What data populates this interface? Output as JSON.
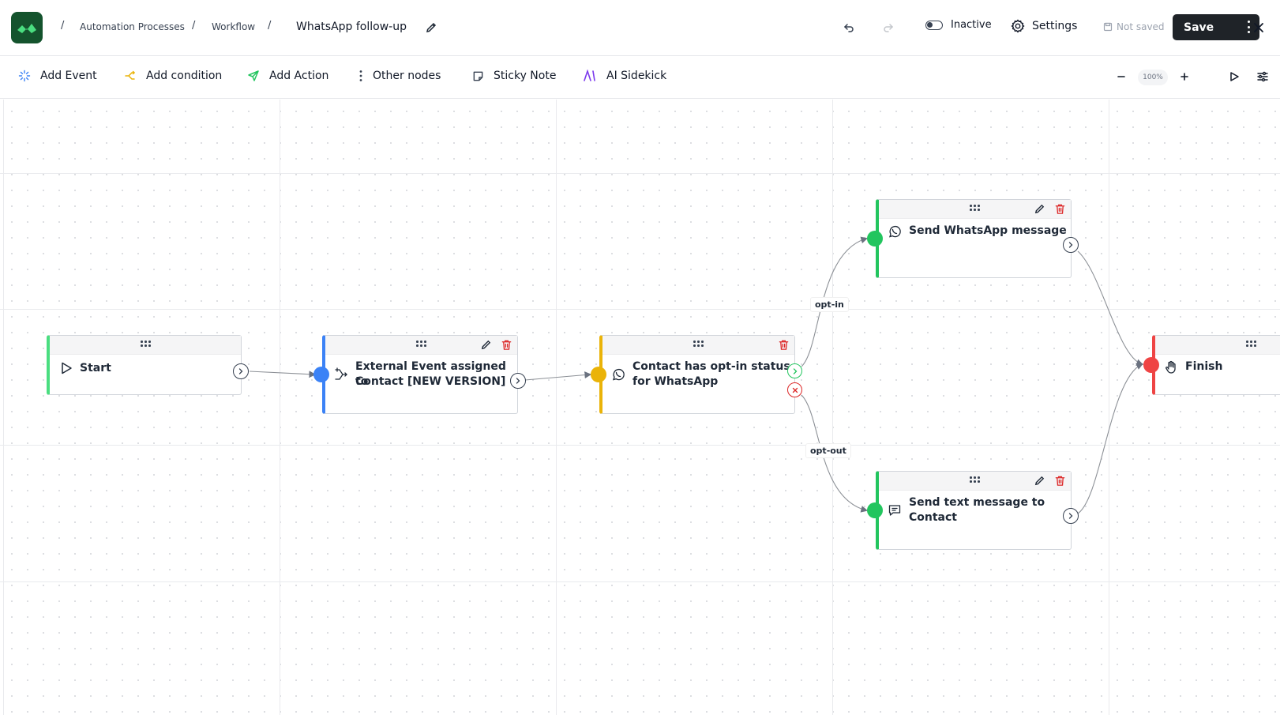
{
  "header": {
    "breadcrumbs": [
      "Automation Processes",
      "Workflow"
    ],
    "workflow_name": "WhatsApp follow-up",
    "status_label": "Inactive",
    "settings_label": "Settings",
    "save_state": "Not saved",
    "save_label": "Save"
  },
  "toolbar": {
    "add_event": "Add Event",
    "add_condition": "Add condition",
    "add_action": "Add Action",
    "other_nodes": "Other nodes",
    "sticky_note": "Sticky Note",
    "ai_sidekick": "AI Sidekick",
    "zoom": "100%"
  },
  "nodes": {
    "start": {
      "title": "Start",
      "color": "#4ade80"
    },
    "external_event": {
      "title_line1": "External Event assigned to",
      "title_line2": "Contact [NEW VERSION]",
      "color": "#3b82f6"
    },
    "condition": {
      "title_line1": "Contact has opt-in status",
      "title_line2": "for WhatsApp",
      "color": "#eab308"
    },
    "send_whatsapp": {
      "title": "Send WhatsApp message",
      "color": "#22c55e"
    },
    "send_text": {
      "title_line1": "Send text message to",
      "title_line2": "Contact",
      "color": "#22c55e"
    },
    "finish": {
      "title": "Finish",
      "color": "#ef4444"
    }
  },
  "edges": {
    "opt_in_label": "opt-in",
    "opt_out_label": "opt-out"
  },
  "icons": {
    "logo": "app-logo-icon",
    "undo": "undo-icon",
    "redo": "redo-icon",
    "settings": "gear-icon",
    "close": "close-icon"
  }
}
